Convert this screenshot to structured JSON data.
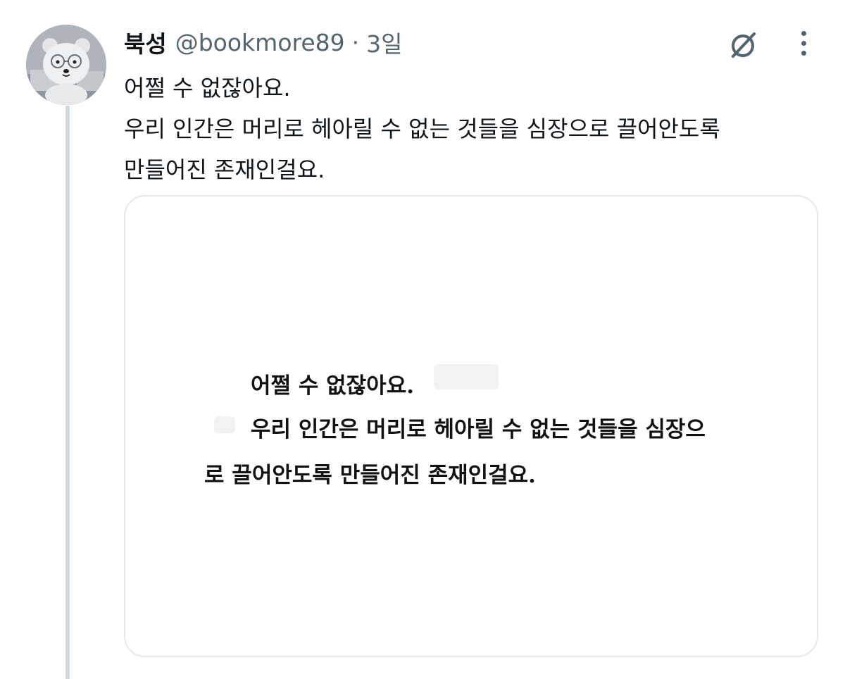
{
  "post": {
    "display_name": "북성",
    "handle": "@bookmore89",
    "separator": "·",
    "time": "3일",
    "text_lines": [
      "어쩔 수 없잖아요.",
      "우리 인간은 머리로 헤아릴 수 없는 것들을 심장으로 끌어안도록",
      "만들어진 존재인걸요."
    ]
  },
  "media": {
    "lines": [
      "어쩔 수 없잖아요.",
      "우리 인간은 머리로 헤아릴 수 없는 것들을 심장으",
      "로 끌어안도록 만들어진 존재인걸요."
    ]
  },
  "icons": {
    "avatar": "avatar-bear-glasses",
    "grok": "grok-icon",
    "more": "more-icon"
  },
  "colors": {
    "text_primary": "#0f1419",
    "text_secondary": "#536471",
    "thread_line": "#cfd9de",
    "card_border": "#e6e9ec"
  }
}
